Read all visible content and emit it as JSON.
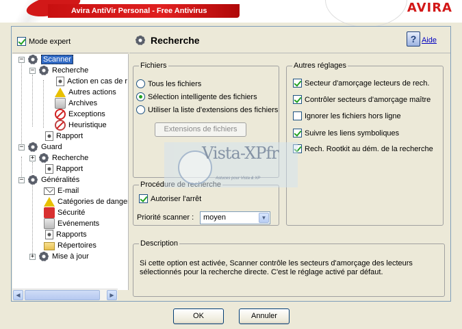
{
  "window": {
    "title": "Avira AntiVir Personal - Free Antivirus",
    "logo": "AVIRA"
  },
  "left_panel": {
    "expert_mode_label": "Mode expert",
    "expert_mode_checked": true,
    "tree": [
      {
        "label": "Scanner",
        "icon": "gear-icon",
        "selected": true
      },
      {
        "label": "Recherche",
        "icon": "gear-icon"
      },
      {
        "label": "Action en cas de r",
        "icon": "document-gear-icon"
      },
      {
        "label": "Autres actions",
        "icon": "warning-flask-icon"
      },
      {
        "label": "Archives",
        "icon": "archive-icon"
      },
      {
        "label": "Exceptions",
        "icon": "ban-icon"
      },
      {
        "label": "Heuristique",
        "icon": "magnifier-icon"
      },
      {
        "label": "Rapport",
        "icon": "document-gear-icon"
      },
      {
        "label": "Guard",
        "icon": "gear-icon"
      },
      {
        "label": "Recherche",
        "icon": "gear-icon"
      },
      {
        "label": "Rapport",
        "icon": "document-gear-icon"
      },
      {
        "label": "Généralités",
        "icon": "gear-icon"
      },
      {
        "label": "E-mail",
        "icon": "envelope-icon"
      },
      {
        "label": "Catégories de dangers",
        "icon": "warning-icon"
      },
      {
        "label": "Sécurité",
        "icon": "security-icon"
      },
      {
        "label": "Evénements",
        "icon": "events-icon"
      },
      {
        "label": "Rapports",
        "icon": "document-gear-icon"
      },
      {
        "label": "Répertoires",
        "icon": "folder-icon"
      },
      {
        "label": "Mise à jour",
        "icon": "gear-icon"
      }
    ]
  },
  "right_panel": {
    "title": "Recherche",
    "help_label": "Aide",
    "fichiers": {
      "legend": "Fichiers",
      "options": [
        {
          "label": "Tous les fichiers",
          "checked": false
        },
        {
          "label": "Sélection intelligente des fichiers",
          "checked": true
        },
        {
          "label": "Utiliser la liste d'extensions des fichiers",
          "checked": false
        }
      ],
      "extensions_button": "Extensions de fichiers"
    },
    "autres_reglages": {
      "legend": "Autres réglages",
      "options": [
        {
          "label": "Secteur d'amorçage lecteurs de rech.",
          "checked": true
        },
        {
          "label": "Contrôler secteurs d'amorçage maître",
          "checked": true
        },
        {
          "label": "Ignorer les fichiers hors ligne",
          "checked": false
        },
        {
          "label": "Suivre les liens symboliques",
          "checked": true
        },
        {
          "label": "Rech. Rootkit au dém. de la recherche",
          "checked": true
        }
      ]
    },
    "procedure": {
      "legend": "Procédure de recherche",
      "allow_stop_label": "Autoriser l'arrêt",
      "allow_stop_checked": true,
      "priority_label": "Priorité scanner :",
      "priority_value": "moyen"
    },
    "description": {
      "legend": "Description",
      "text": "Si cette option est activée, Scanner contrôle les secteurs d'amorçage des lecteurs sélectionnés pour la recherche directe. C'est le réglage activé par défaut."
    }
  },
  "footer": {
    "ok_label": "OK",
    "cancel_label": "Annuler"
  },
  "watermark": {
    "text": "Vista-XPfr",
    "subtext": "Astuces pour Vista & XP"
  }
}
